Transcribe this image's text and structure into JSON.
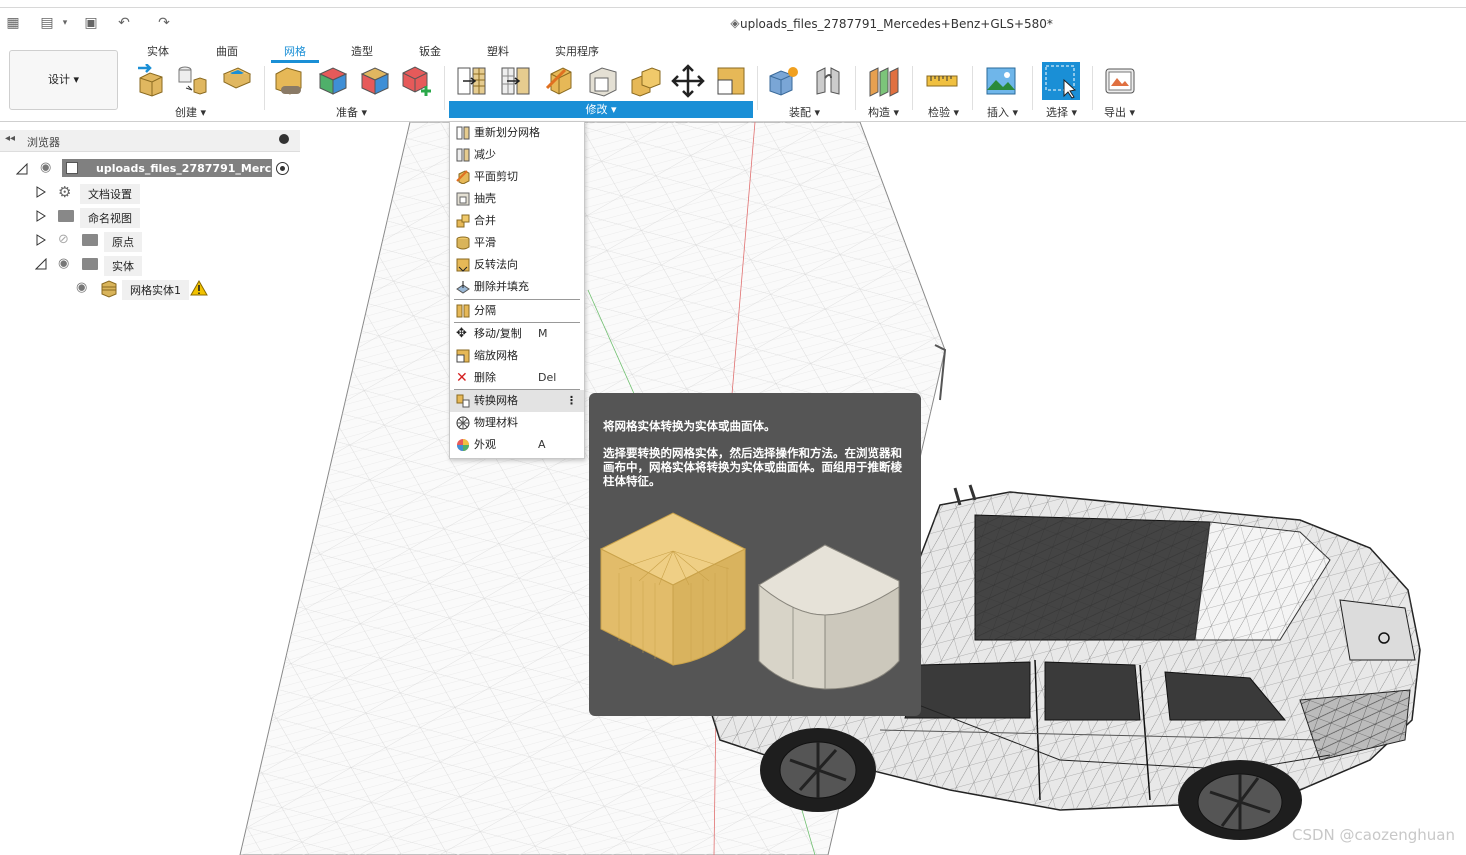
{
  "document": {
    "title": "uploads_files_2787791_Mercedes+Benz+GLS+580*"
  },
  "quick_access": {
    "icons": [
      "apps-grid-icon",
      "file-icon",
      "save-icon",
      "undo-icon",
      "redo-icon"
    ]
  },
  "ribbon": {
    "tabs": [
      "实体",
      "曲面",
      "网格",
      "造型",
      "钣金",
      "塑料",
      "实用程序"
    ],
    "active_tab": "网格",
    "design_button": "设计 ▾",
    "groups": {
      "create": "创建 ▾",
      "prepare": "准备 ▾",
      "modify": "修改 ▾",
      "assemble": "装配 ▾",
      "construct": "构造 ▾",
      "inspect": "检验 ▾",
      "insert": "插入 ▾",
      "select": "选择 ▾",
      "export": "导出 ▾"
    },
    "accent": "#1a8fd6"
  },
  "browser": {
    "title": "浏览器",
    "root": "uploads_files_2787791_Merc...",
    "items": [
      {
        "label": "文档设置"
      },
      {
        "label": "命名视图"
      },
      {
        "label": "原点"
      },
      {
        "label": "实体"
      },
      {
        "label": "网格实体1"
      }
    ]
  },
  "menu": {
    "items": [
      {
        "label": "重新划分网格",
        "shortcut": ""
      },
      {
        "label": "减少",
        "shortcut": ""
      },
      {
        "label": "平面剪切",
        "shortcut": ""
      },
      {
        "label": "抽壳",
        "shortcut": ""
      },
      {
        "label": "合并",
        "shortcut": ""
      },
      {
        "label": "平滑",
        "shortcut": ""
      },
      {
        "label": "反转法向",
        "shortcut": ""
      },
      {
        "label": "删除并填充",
        "shortcut": ""
      },
      {
        "label": "分隔",
        "shortcut": ""
      },
      {
        "label": "移动/复制",
        "shortcut": "M"
      },
      {
        "label": "缩放网格",
        "shortcut": ""
      },
      {
        "label": "删除",
        "shortcut": "Del"
      },
      {
        "label": "转换网格",
        "shortcut": ""
      },
      {
        "label": "物理材料",
        "shortcut": ""
      },
      {
        "label": "外观",
        "shortcut": "A"
      }
    ],
    "highlighted": "转换网格"
  },
  "tooltip": {
    "title": "将网格实体转换为实体或曲面体。",
    "body": "选择要转换的网格实体，然后选择操作和方法。在浏览器和画布中，网格实体将转换为实体或曲面体。面组用于推断棱柱体特征。"
  },
  "watermark": "CSDN @caozenghuan"
}
